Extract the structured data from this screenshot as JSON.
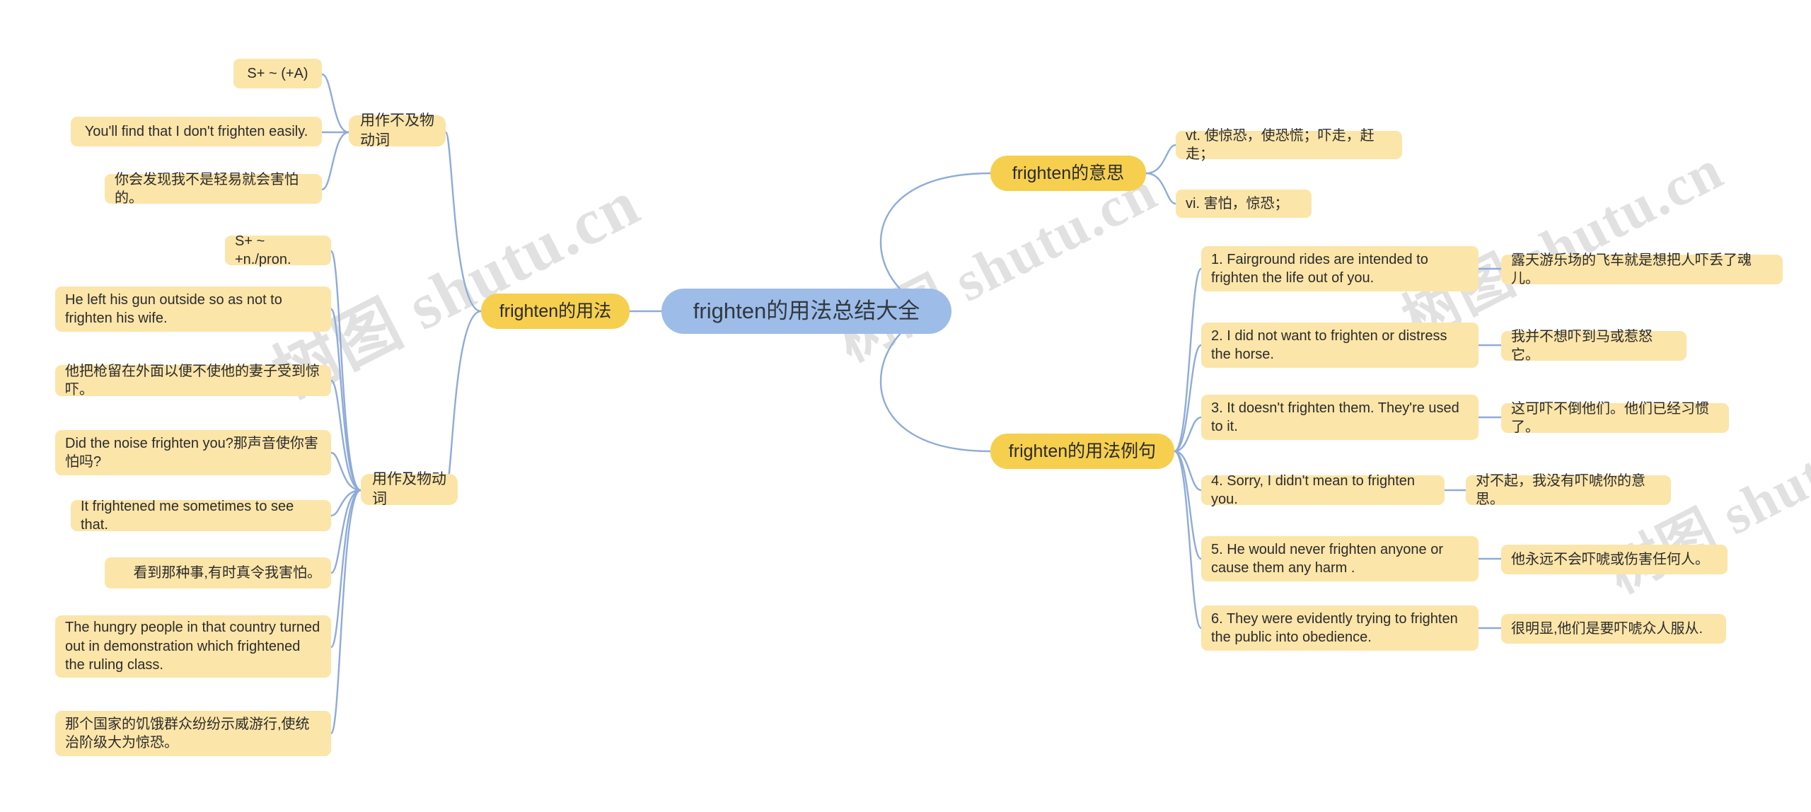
{
  "mindmap": {
    "title": "frighten的用法总结大全",
    "watermark_text": "树图 shutu.cn",
    "colors": {
      "root": "#9DBCE8",
      "main_branch": "#F6CF4E",
      "sub_branch": "#FBE4A6",
      "leaf": "#FCE5A9",
      "connector": "#8FABD8",
      "watermark": "#B9B9B9",
      "text": "#2B2B2B",
      "background": "#FFFFFF"
    },
    "branches": {
      "usage": {
        "label": "frighten的用法",
        "intransitive": {
          "label": "用作不及物动词",
          "items": [
            "S+ ~ (+A)",
            "You'll find that I don't frighten easily.",
            "你会发现我不是轻易就会害怕的。"
          ]
        },
        "transitive": {
          "label": "用作及物动词",
          "items": [
            "S+ ~ +n./pron.",
            "He left his gun outside so as not to frighten his wife.",
            "他把枪留在外面以便不使他的妻子受到惊吓。",
            "Did the noise frighten you?那声音使你害怕吗?",
            "It frightened me sometimes to see that.",
            "看到那种事,有时真令我害怕。",
            "The hungry people in that country turned out in demonstration which frightened the ruling class.",
            "那个国家的饥饿群众纷纷示威游行,使统治阶级大为惊恐。"
          ]
        }
      },
      "meaning": {
        "label": "frighten的意思",
        "definitions": [
          "vt. 使惊恐，使恐慌；吓走，赶走；",
          "vi. 害怕，惊恐；"
        ]
      },
      "examples": {
        "label": "frighten的用法例句",
        "items": [
          {
            "english": "1. Fairground rides are intended to frighten the life out of you.",
            "chinese": "露天游乐场的飞车就是想把人吓丢了魂儿。"
          },
          {
            "english": "2. I did not want to frighten or distress the horse.",
            "chinese": "我并不想吓到马或惹怒它。"
          },
          {
            "english": "3. It doesn't frighten them. They're used to it.",
            "chinese": "这可吓不倒他们。他们已经习惯了。"
          },
          {
            "english": "4. Sorry, I didn't mean to frighten you.",
            "chinese": "对不起，我没有吓唬你的意思。"
          },
          {
            "english": "5. He would never frighten anyone or cause them any harm .",
            "chinese": "他永远不会吓唬或伤害任何人。"
          },
          {
            "english": "6. They were evidently trying to frighten the public into obedience.",
            "chinese": "很明显,他们是要吓唬众人服从."
          }
        ]
      }
    }
  }
}
